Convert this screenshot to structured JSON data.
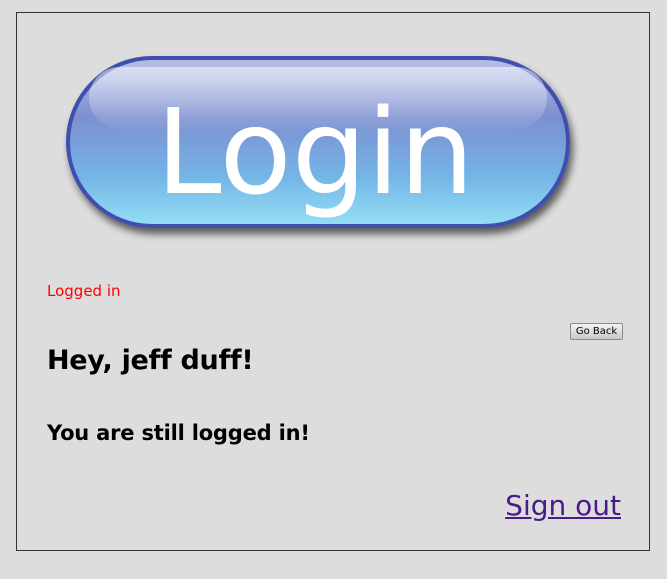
{
  "banner": {
    "label": "Login"
  },
  "status": {
    "text": "Logged in",
    "color": "#ff0000"
  },
  "actions": {
    "go_back_label": "Go Back",
    "sign_out_label": "Sign out"
  },
  "content": {
    "greeting": "Hey, jeff duff!",
    "message": "You are still logged in!"
  },
  "colors": {
    "background": "#dddddd",
    "link": "#4b1a8a",
    "banner_top": "#c7cce8",
    "banner_bottom": "#8fd9f3",
    "banner_border": "#3f4fae"
  }
}
